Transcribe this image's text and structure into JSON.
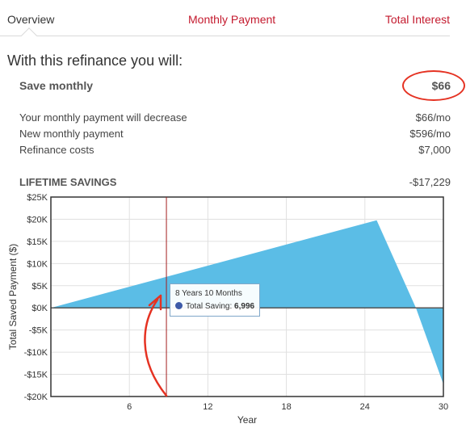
{
  "tabs": [
    {
      "label": "Overview",
      "active": true
    },
    {
      "label": "Monthly Payment",
      "active": false
    },
    {
      "label": "Total Interest",
      "active": false
    }
  ],
  "heading": "With this refinance you will:",
  "save_monthly": {
    "label": "Save monthly",
    "value": "$66"
  },
  "details": [
    {
      "label": "Your monthly payment will decrease",
      "value": "$66/mo"
    },
    {
      "label": "New monthly payment",
      "value": "$596/mo"
    },
    {
      "label": "Refinance costs",
      "value": "$7,000"
    }
  ],
  "lifetime": {
    "label": "LIFETIME SAVINGS",
    "value": "-$17,229"
  },
  "colors": {
    "accent": "#c41a2e",
    "area": "#5bbde6",
    "annotation": "#e53222"
  },
  "tooltip": {
    "title": "8 Years 10 Months",
    "series_label": "Total Saving:",
    "series_value": "6,996"
  },
  "chart_data": {
    "type": "area",
    "xlabel": "Year",
    "ylabel": "Total Saved Payment ($)",
    "xlim": [
      0,
      30
    ],
    "ylim": [
      -20000,
      25000
    ],
    "xticks": [
      6,
      12,
      18,
      24,
      30
    ],
    "xtick_labels": [
      "6",
      "12",
      "18",
      "24",
      "30"
    ],
    "yticks": [
      25000,
      20000,
      15000,
      10000,
      5000,
      0,
      -5000,
      -10000,
      -15000,
      -20000
    ],
    "ytick_labels": [
      "$25K",
      "$20K",
      "$15K",
      "$10K",
      "$5K",
      "$0K",
      "-$5K",
      "-$10K",
      "-$15K",
      "-$20K"
    ],
    "grid": true,
    "series": [
      {
        "x": [
          0,
          24.9,
          27.9,
          30
        ],
        "y": [
          0,
          19770,
          0,
          -17229
        ]
      }
    ],
    "cursor_x": 8.83
  }
}
